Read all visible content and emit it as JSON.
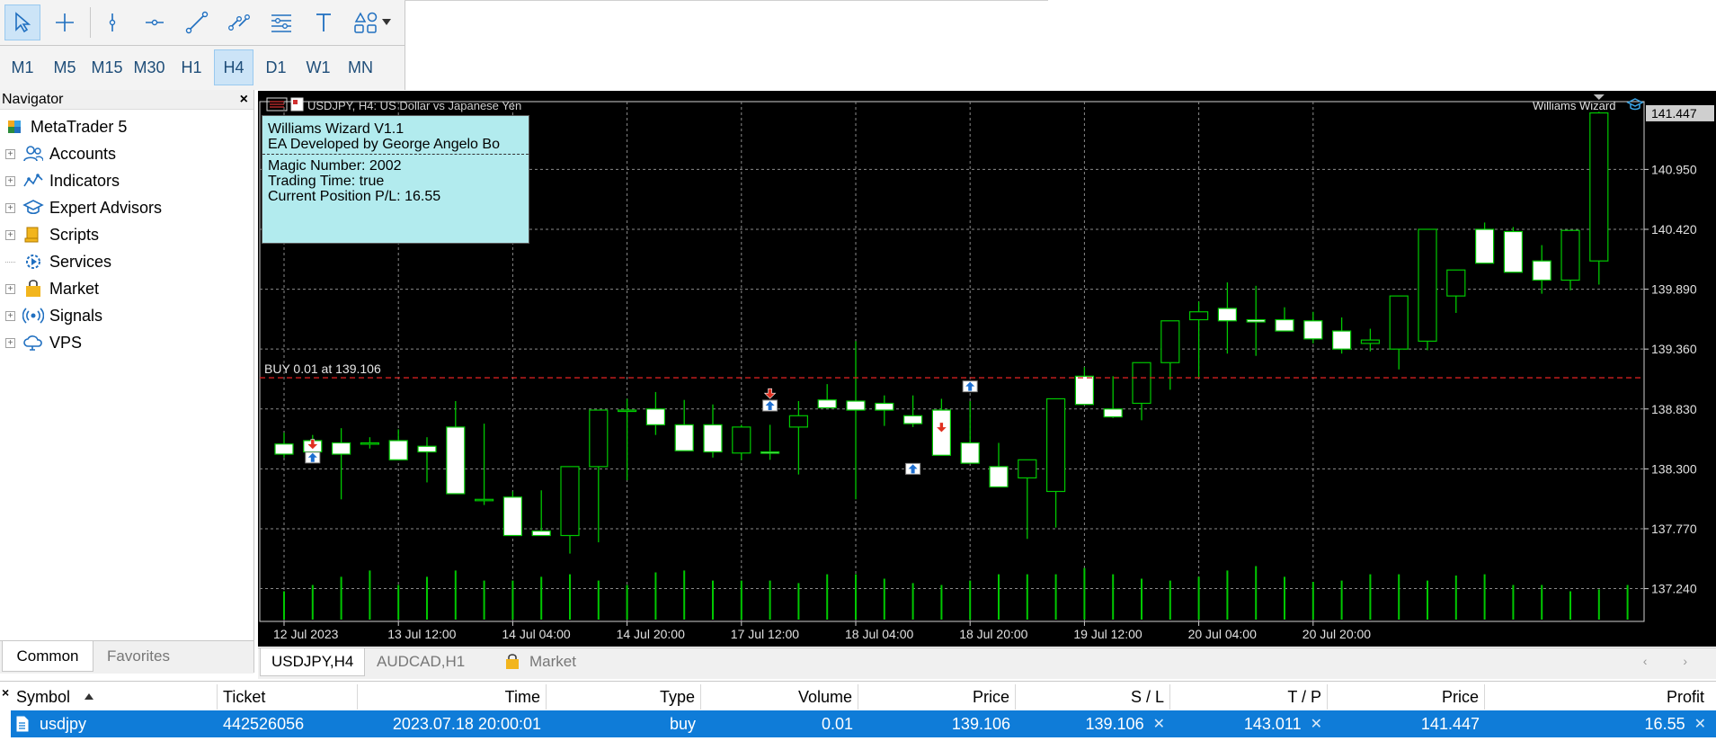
{
  "toolbar": {
    "tools": [
      "cursor-icon",
      "crosshair-icon",
      "vertical-line-icon",
      "horizontal-line-icon",
      "trendline-icon",
      "channel-icon",
      "fibonacci-icon",
      "text-icon",
      "shapes-icon"
    ]
  },
  "timeframes": [
    "M1",
    "M5",
    "M15",
    "M30",
    "H1",
    "H4",
    "D1",
    "W1",
    "MN"
  ],
  "timeframe_active": "H4",
  "navigator": {
    "title": "Navigator",
    "close": "×",
    "root": "MetaTrader 5",
    "items": [
      {
        "label": "Accounts",
        "icon": "accounts-icon",
        "expandable": true
      },
      {
        "label": "Indicators",
        "icon": "indicators-icon",
        "expandable": true
      },
      {
        "label": "Expert Advisors",
        "icon": "expert-advisors-icon",
        "expandable": true
      },
      {
        "label": "Scripts",
        "icon": "scripts-icon",
        "expandable": true
      },
      {
        "label": "Services",
        "icon": "services-icon",
        "expandable": false
      },
      {
        "label": "Market",
        "icon": "market-icon",
        "expandable": true
      },
      {
        "label": "Signals",
        "icon": "signals-icon",
        "expandable": true
      },
      {
        "label": "VPS",
        "icon": "vps-icon",
        "expandable": true
      }
    ],
    "tabs": {
      "common": "Common",
      "favorites": "Favorites"
    }
  },
  "chart": {
    "header": "USDJPY, H4:  US Dollar vs Japanese Yen",
    "ea_label": "Williams Wizard",
    "current_price": "141.447",
    "order_line_label": "BUY 0.01 at 139.106",
    "info_panel": {
      "line1": "Williams Wizard V1.1",
      "line2": "EA Developed by George Angelo Bo",
      "line3": "Magic Number: 2002",
      "line4": "Trading Time: true",
      "line5": "Current Position P/L: 16.55"
    },
    "price_labels": [
      "140.950",
      "140.420",
      "139.890",
      "139.360",
      "138.830",
      "138.300",
      "137.770",
      "137.240"
    ],
    "time_labels": [
      "12 Jul 2023",
      "13 Jul 12:00",
      "14 Jul 04:00",
      "14 Jul 20:00",
      "17 Jul 12:00",
      "18 Jul 04:00",
      "18 Jul 20:00",
      "19 Jul 12:00",
      "20 Jul 04:00",
      "20 Jul 20:00"
    ],
    "colors": {
      "background": "#000000",
      "bull_body": "#000000",
      "bear_body": "#ffffff",
      "wick": "#00c800",
      "grid": "#8a8a8a",
      "order_line": "#d02020",
      "buy_arrow": "#1e6fd0",
      "sell_arrow": "#e03020"
    }
  },
  "chart_data": {
    "type": "candlestick",
    "ylim": [
      136.95,
      141.55
    ],
    "series": [
      {
        "open": [
          138.52,
          138.55,
          138.53,
          138.53,
          138.55,
          138.5,
          138.67,
          138.03,
          138.05,
          137.75,
          137.71,
          138.32,
          138.82,
          138.83,
          138.69,
          138.69,
          138.44,
          138.45,
          138.67,
          138.91,
          138.9,
          138.88,
          138.77,
          138.82,
          138.53,
          138.32,
          138.22,
          138.1,
          139.12,
          138.83,
          138.88,
          139.24,
          139.62,
          139.72,
          139.62,
          139.62,
          139.61,
          139.52,
          139.41,
          139.36,
          139.43,
          139.83,
          140.42,
          140.4,
          140.14,
          139.97,
          140.14
        ],
        "high": [
          138.62,
          138.6,
          138.66,
          138.58,
          138.65,
          138.58,
          138.9,
          138.7,
          138.1,
          138.11,
          137.8,
          138.45,
          138.92,
          138.98,
          138.91,
          138.87,
          138.69,
          138.69,
          138.9,
          139.05,
          139.43,
          138.95,
          138.95,
          138.92,
          138.9,
          138.53,
          138.32,
          138.7,
          139.2,
          139.12,
          139.2,
          139.6,
          139.78,
          139.95,
          139.92,
          139.73,
          139.69,
          139.64,
          139.54,
          139.44,
          139.66,
          139.97,
          140.48,
          140.44,
          140.28,
          140.19,
          141.46
        ],
        "low": [
          138.4,
          138.45,
          138.03,
          138.48,
          138.4,
          138.18,
          138.48,
          137.98,
          137.98,
          137.72,
          137.55,
          137.65,
          138.2,
          138.6,
          138.55,
          138.4,
          138.38,
          138.38,
          138.25,
          138.87,
          138.03,
          138.68,
          138.67,
          138.6,
          138.4,
          138.2,
          137.68,
          137.78,
          138.98,
          138.75,
          138.73,
          139.0,
          139.1,
          139.32,
          139.3,
          139.56,
          139.41,
          139.32,
          139.34,
          139.18,
          139.35,
          139.68,
          140.4,
          140.12,
          139.85,
          139.88,
          139.93
        ],
        "close": [
          138.43,
          138.45,
          138.43,
          138.53,
          138.38,
          138.45,
          138.08,
          138.03,
          137.71,
          137.71,
          138.32,
          138.82,
          138.82,
          138.69,
          138.46,
          138.45,
          138.67,
          138.44,
          138.77,
          138.84,
          138.82,
          138.82,
          138.7,
          138.42,
          138.35,
          138.14,
          138.38,
          138.92,
          138.87,
          138.76,
          139.24,
          139.61,
          139.69,
          139.61,
          139.6,
          139.52,
          139.45,
          139.36,
          139.44,
          139.83,
          140.42,
          140.06,
          140.12,
          140.04,
          139.97,
          140.41,
          141.45
        ]
      }
    ],
    "volume": [
      0.45,
      0.55,
      0.68,
      0.78,
      0.55,
      0.68,
      0.78,
      0.62,
      0.62,
      0.68,
      0.72,
      0.62,
      0.55,
      0.75,
      0.78,
      0.62,
      0.62,
      0.62,
      0.58,
      0.72,
      0.72,
      0.65,
      0.58,
      0.55,
      0.62,
      0.72,
      0.72,
      0.72,
      0.82,
      0.72,
      0.65,
      0.62,
      0.68,
      0.78,
      0.85,
      0.68,
      0.6,
      0.62,
      0.72,
      0.72,
      0.62,
      0.7,
      0.72,
      0.55,
      0.55,
      0.45,
      0.48,
      0.55
    ]
  },
  "chart_tabs": [
    {
      "label": "USDJPY,H4",
      "active": true
    },
    {
      "label": "AUDCAD,H1",
      "active": false
    },
    {
      "label": "Market",
      "active": false,
      "icon": "market-icon"
    }
  ],
  "terminal": {
    "close": "×",
    "columns": [
      "Symbol",
      "Ticket",
      "Time",
      "Type",
      "Volume",
      "Price",
      "S / L",
      "T / P",
      "Price",
      "Profit"
    ],
    "rows": [
      {
        "symbol": "usdjpy",
        "ticket": "442526056",
        "time": "2023.07.18 20:00:01",
        "type": "buy",
        "volume": "0.01",
        "open_price": "139.106",
        "sl": "139.106",
        "tp": "143.011",
        "price": "141.447",
        "profit": "16.55"
      }
    ]
  }
}
